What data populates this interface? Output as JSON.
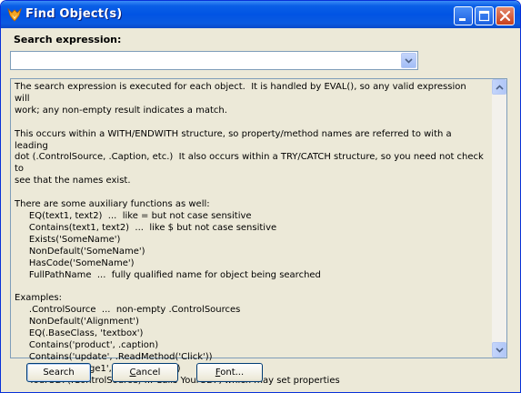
{
  "window": {
    "title": "Find Object(s)",
    "icon": "fox-app-icon"
  },
  "title_buttons": [
    "minimize-icon",
    "maximize-icon",
    "close-icon"
  ],
  "search": {
    "label": "Search expression:",
    "value": ""
  },
  "help_text": "The search expression is executed for each object.  It is handled by EVAL(), so any valid expression will\nwork; any non-empty result indicates a match.\n\nThis occurs within a WITH/ENDWITH structure, so property/method names are referred to with a leading\ndot (.ControlSource, .Caption, etc.)  It also occurs within a TRY/CATCH structure, so you need not check to\nsee that the names exist.\n\nThere are some auxiliary functions as well:\n     EQ(text1, text2)  ...  like = but not case sensitive\n     Contains(text1, text2)  ...  like $ but not case sensitive\n     Exists('SomeName')\n     NonDefault('SomeName')\n     HasCode('SomeName')\n     FullPathName  ...  fully qualified name for object being searched\n\nExamples:\n     .ControlSource  ...  non-empty .ControlSources\n     NonDefault('Alignment')\n     EQ(.BaseClass, 'textbox')\n     Contains('product', .caption)\n     Contains('update', .ReadMethod('Click'))\n     Contains('.page1', FullPathName)\n     YourUDF(.ControlSource) ... Calls YourUDF, which may set properties",
  "buttons": {
    "search": "Search",
    "cancel_before": "",
    "cancel_hotkey": "C",
    "cancel_after": "ancel",
    "font_before": "",
    "font_hotkey": "F",
    "font_after": "ont..."
  },
  "colors": {
    "titlebar": "#0154e4",
    "dialog_bg": "#ece9d8",
    "border": "#7f9db9"
  }
}
